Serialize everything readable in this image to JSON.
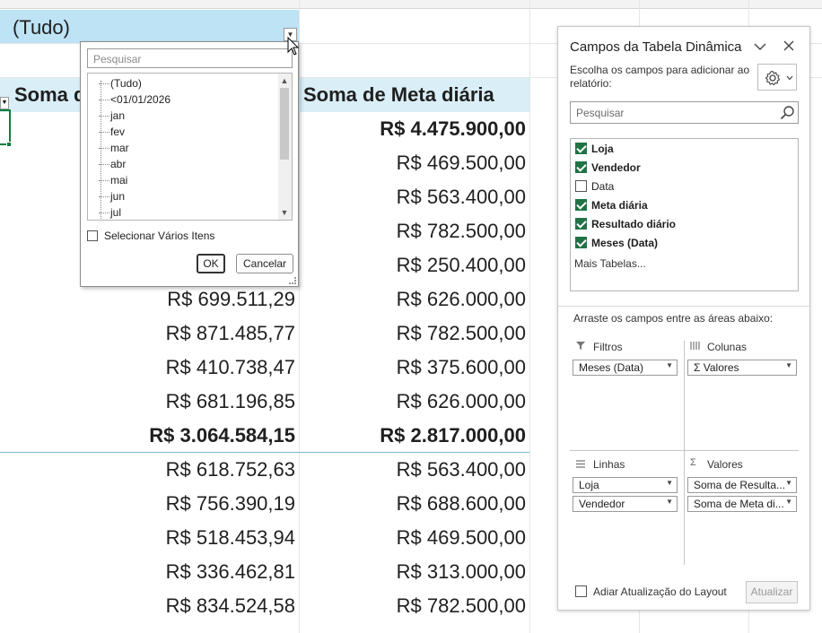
{
  "sheet": {
    "filter_value": "(Tudo)",
    "pivot_headers": {
      "col_soma": "Soma d",
      "col_meta": "Soma de Meta diária"
    },
    "rows": [
      {
        "result": "",
        "meta": "R$ 4.475.900,00",
        "bold": true
      },
      {
        "result": "",
        "meta": "R$ 469.500,00",
        "bold": false
      },
      {
        "result": "",
        "meta": "R$ 563.400,00",
        "bold": false
      },
      {
        "result": "",
        "meta": "R$ 782.500,00",
        "bold": false
      },
      {
        "result": "",
        "meta": "R$ 250.400,00",
        "bold": false
      },
      {
        "result": "R$ 699.511,29",
        "meta": "R$ 626.000,00",
        "bold": false
      },
      {
        "result": "R$ 871.485,77",
        "meta": "R$ 782.500,00",
        "bold": false
      },
      {
        "result": "R$ 410.738,47",
        "meta": "R$ 375.600,00",
        "bold": false
      },
      {
        "result": "R$ 681.196,85",
        "meta": "R$ 626.000,00",
        "bold": false
      },
      {
        "result": "R$ 3.064.584,15",
        "meta": "R$ 2.817.000,00",
        "bold": true
      },
      {
        "result": "R$ 618.752,63",
        "meta": "R$ 563.400,00",
        "bold": false
      },
      {
        "result": "R$ 756.390,19",
        "meta": "R$ 688.600,00",
        "bold": false
      },
      {
        "result": "R$ 518.453,94",
        "meta": "R$ 469.500,00",
        "bold": false
      },
      {
        "result": "R$ 336.462,81",
        "meta": "R$ 313.000,00",
        "bold": false
      },
      {
        "result": "R$ 834.524,58",
        "meta": "R$ 782.500,00",
        "bold": false
      }
    ]
  },
  "filter_popup": {
    "search_placeholder": "Pesquisar",
    "items": [
      "(Tudo)",
      "<01/01/2026",
      "jan",
      "fev",
      "mar",
      "abr",
      "mai",
      "jun",
      "jul"
    ],
    "multi_select_label": "Selecionar Vários Itens",
    "ok_label": "OK",
    "cancel_label": "Cancelar"
  },
  "pivot_pane": {
    "title": "Campos da Tabela Dinâmica",
    "subtitle": "Escolha os campos para adicionar ao relatório:",
    "search_placeholder": "Pesquisar",
    "fields": [
      {
        "label": "Loja",
        "checked": true
      },
      {
        "label": "Vendedor",
        "checked": true
      },
      {
        "label": "Data",
        "checked": false
      },
      {
        "label": "Meta diária",
        "checked": true
      },
      {
        "label": "Resultado diário",
        "checked": true
      },
      {
        "label": "Meses (Data)",
        "checked": true
      }
    ],
    "more_tables": "Mais Tabelas...",
    "drag_hint": "Arraste os campos entre as áreas abaixo:",
    "areas": {
      "filters": {
        "title": "Filtros",
        "items": [
          "Meses (Data)"
        ]
      },
      "columns": {
        "title": "Colunas",
        "items": [
          "Σ  Valores"
        ]
      },
      "rows": {
        "title": "Linhas",
        "items": [
          "Loja",
          "Vendedor"
        ]
      },
      "values": {
        "title": "Valores",
        "items": [
          "Soma de Resulta...",
          "Soma de Meta di..."
        ]
      }
    },
    "defer_label": "Adiar Atualização do Layout",
    "update_label": "Atualizar"
  }
}
